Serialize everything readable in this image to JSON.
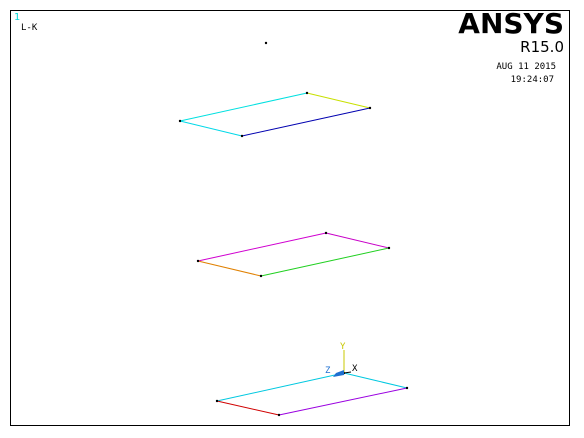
{
  "window": {
    "number": "1",
    "plot_label": "L-K"
  },
  "branding": {
    "product": "ANSYS",
    "release": "R15.0"
  },
  "timestamp": {
    "date": "AUG 11 2015",
    "time": "19:24:07"
  },
  "triad": {
    "x_label": "X",
    "y_label": "Y",
    "z_label": "Z"
  },
  "colors": {
    "background": "#ffffff",
    "frame": "#000000",
    "window_number": "#00d8d8",
    "triad_x": "#000000",
    "triad_y": "#c8c800",
    "triad_z": "#1e6fd0",
    "keypoint": "#000000"
  },
  "line_groups": [
    {
      "name": "top-area",
      "lines": [
        {
          "color": "#00e0e0"
        },
        {
          "color": "#c8e000"
        },
        {
          "color": "#0000b0"
        },
        {
          "color": "#00d8e8"
        }
      ]
    },
    {
      "name": "middle-area",
      "lines": [
        {
          "color": "#d000d0"
        },
        {
          "color": "#c800c8"
        },
        {
          "color": "#20d020"
        },
        {
          "color": "#e08000"
        }
      ]
    },
    {
      "name": "bottom-area",
      "lines": [
        {
          "color": "#00c8e0"
        },
        {
          "color": "#00c8e0"
        },
        {
          "color": "#9a00e0"
        },
        {
          "color": "#d00000"
        }
      ]
    }
  ]
}
